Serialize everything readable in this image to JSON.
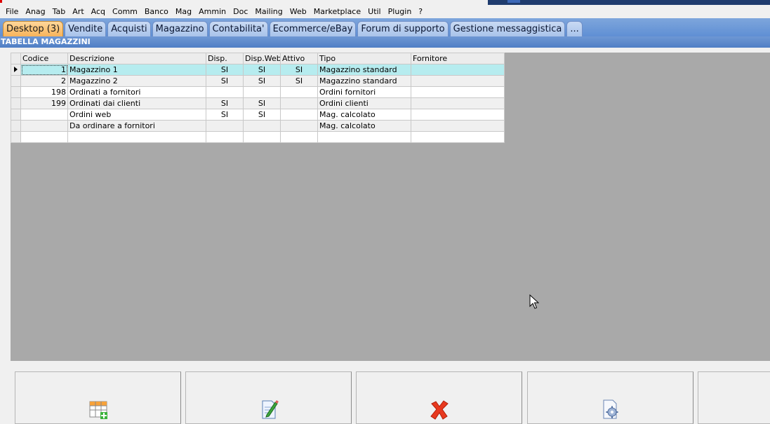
{
  "menu": [
    "File",
    "Anag",
    "Tab",
    "Art",
    "Acq",
    "Comm",
    "Banco",
    "Mag",
    "Ammin",
    "Doc",
    "Mailing",
    "Web",
    "Marketplace",
    "Util",
    "Plugin",
    "?"
  ],
  "tabs": [
    "Desktop (3)",
    "Vendite",
    "Acquisti",
    "Magazzino",
    "Contabilita'",
    "Ecommerce/eBay",
    "Forum di supporto",
    "Gestione messaggistica",
    "..."
  ],
  "section_title": "TABELLA MAGAZZINI",
  "table": {
    "columns": [
      "Codice",
      "Descrizione",
      "Disp.",
      "Disp.Web",
      "Attivo",
      "Tipo",
      "Fornitore"
    ],
    "rows": [
      [
        "1",
        "Magazzino 1",
        "SI",
        "SI",
        "SI",
        "Magazzino standard",
        ""
      ],
      [
        "2",
        "Magazzino 2",
        "SI",
        "SI",
        "SI",
        "Magazzino standard",
        ""
      ],
      [
        "198",
        "Ordinati a fornitori",
        "",
        "",
        "",
        "Ordini fornitori",
        ""
      ],
      [
        "199",
        "Ordinati dai clienti",
        "SI",
        "SI",
        "",
        "Ordini clienti",
        ""
      ],
      [
        "",
        "Ordini web",
        "SI",
        "SI",
        "",
        "Mag. calcolato",
        ""
      ],
      [
        "",
        "Da ordinare a fornitori",
        "",
        "",
        "",
        "Mag. calcolato",
        ""
      ],
      [
        "",
        "",
        "",
        "",
        "",
        "",
        ""
      ]
    ]
  },
  "buttons": [
    {
      "icon": "new-record-icon"
    },
    {
      "icon": "edit-document-icon"
    },
    {
      "icon": "delete-x-icon"
    },
    {
      "icon": "document-settings-icon"
    },
    {
      "icon": ""
    }
  ]
}
